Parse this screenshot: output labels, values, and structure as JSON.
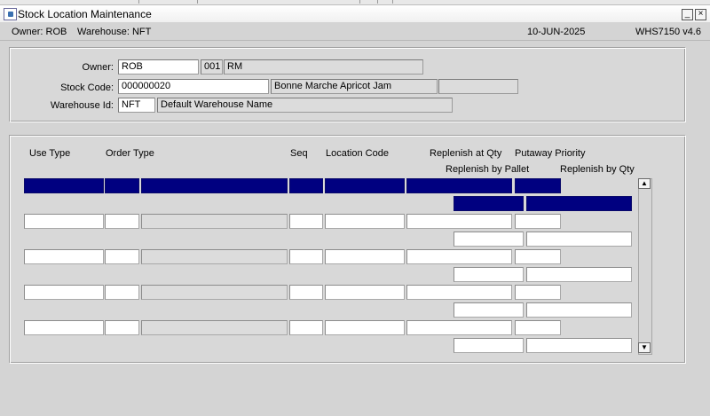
{
  "window": {
    "title": "Stock Location Maintenance",
    "minimize_glyph": "_",
    "close_glyph": "×"
  },
  "infobar": {
    "owner_text": "Owner:  ROB",
    "warehouse_text": "Warehouse:  NFT",
    "date": "10-JUN-2025",
    "program": "WHS7150  v4.6"
  },
  "header": {
    "owner_label": "Owner:",
    "owner_code": "ROB",
    "owner_number": "001",
    "owner_short": "RM",
    "owner_extra": "",
    "stock_code_label": "Stock Code:",
    "stock_code": "000000020",
    "stock_description": "Bonne Marche Apricot Jam",
    "stock_extra1": "",
    "stock_extra2": "",
    "warehouse_label": "Warehouse Id:",
    "warehouse_id": "NFT",
    "warehouse_name": "Default Warehouse Name"
  },
  "grid": {
    "columns": {
      "use_type": "Use Type",
      "order_type": "Order Type",
      "seq": "Seq",
      "location_code": "Location Code",
      "replenish_at_qty": "Replenish at Qty",
      "putaway_priority": "Putaway Priority",
      "replenish_by_pallet": "Replenish by Pallet",
      "replenish_by_qty": "Replenish by Qty"
    },
    "rows": [
      {
        "use_type": "",
        "order_type": "",
        "order_desc": "",
        "seq": "",
        "location_code": "",
        "replenish_at_qty": "",
        "putaway_priority": "",
        "replenish_by_pallet": "",
        "replenish_by_qty": "",
        "selected": true
      },
      {
        "use_type": "",
        "order_type": "",
        "order_desc": "",
        "seq": "",
        "location_code": "",
        "replenish_at_qty": "",
        "putaway_priority": "",
        "replenish_by_pallet": "",
        "replenish_by_qty": "",
        "selected": false
      },
      {
        "use_type": "",
        "order_type": "",
        "order_desc": "",
        "seq": "",
        "location_code": "",
        "replenish_at_qty": "",
        "putaway_priority": "",
        "replenish_by_pallet": "",
        "replenish_by_qty": "",
        "selected": false
      },
      {
        "use_type": "",
        "order_type": "",
        "order_desc": "",
        "seq": "",
        "location_code": "",
        "replenish_at_qty": "",
        "putaway_priority": "",
        "replenish_by_pallet": "",
        "replenish_by_qty": "",
        "selected": false
      },
      {
        "use_type": "",
        "order_type": "",
        "order_desc": "",
        "seq": "",
        "location_code": "",
        "replenish_at_qty": "",
        "putaway_priority": "",
        "replenish_by_pallet": "",
        "replenish_by_qty": "",
        "selected": false
      }
    ],
    "scroll_up_glyph": "▲",
    "scroll_down_glyph": "▼",
    "dropdown_glyph": "▼"
  },
  "colors": {
    "selected_row": "#000080",
    "field_readonly": "#dcdcdc",
    "field": "#ffffff",
    "background": "#d4d4d4"
  }
}
